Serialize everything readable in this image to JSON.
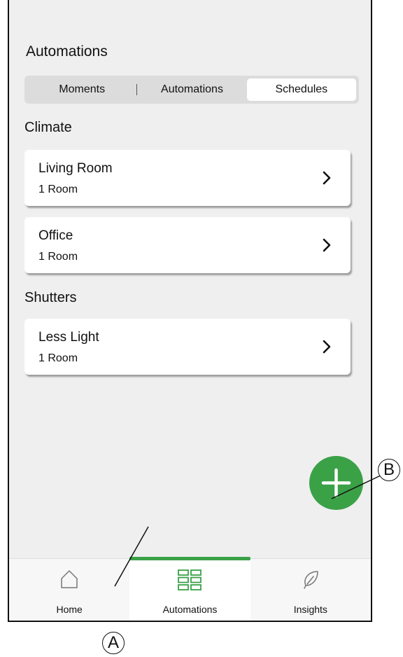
{
  "page_title": "Automations",
  "tabs": [
    {
      "label": "Moments",
      "active": false
    },
    {
      "label": "Automations",
      "active": false
    },
    {
      "label": "Schedules",
      "active": true
    }
  ],
  "sections": [
    {
      "title": "Climate",
      "items": [
        {
          "title": "Living Room",
          "subtitle": "1 Room"
        },
        {
          "title": "Office",
          "subtitle": "1 Room"
        }
      ]
    },
    {
      "title": "Shutters",
      "items": [
        {
          "title": "Less Light",
          "subtitle": "1 Room"
        }
      ]
    }
  ],
  "fab": {
    "icon": "plus-icon"
  },
  "bottom_nav": [
    {
      "label": "Home",
      "icon": "home-icon",
      "active": false
    },
    {
      "label": "Automations",
      "icon": "grid-icon",
      "active": true
    },
    {
      "label": "Insights",
      "icon": "leaf-icon",
      "active": false
    }
  ],
  "callouts": {
    "a": "A",
    "b": "B"
  },
  "colors": {
    "accent": "#3aa147",
    "background": "#efefef"
  }
}
